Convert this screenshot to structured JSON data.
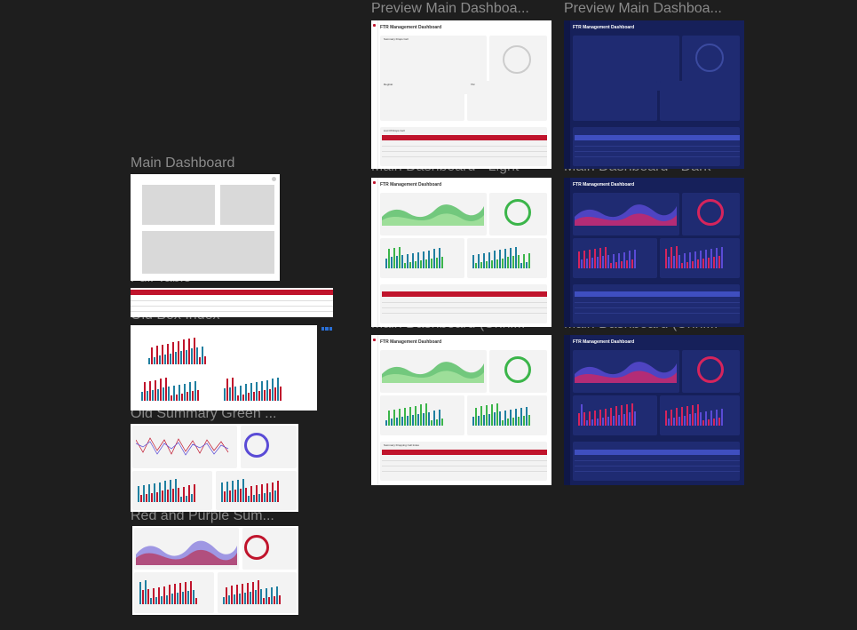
{
  "canvas": {
    "frames": [
      {
        "id": "preview-light",
        "label": "Preview Main Dashboa..."
      },
      {
        "id": "preview-dark",
        "label": "Preview Main Dashboa..."
      },
      {
        "id": "main-wire",
        "label": "Main Dashboard"
      },
      {
        "id": "main-light",
        "label": "Main Dashboard - Light"
      },
      {
        "id": "main-dark",
        "label": "Main Dashboard - Dark"
      },
      {
        "id": "full-table",
        "label": "Full Table"
      },
      {
        "id": "old-box",
        "label": "Old Box Index"
      },
      {
        "id": "unh-light",
        "label": "Main Dashboard (Unhi..."
      },
      {
        "id": "unh-dark",
        "label": "Main Dashboard (Unhi..."
      },
      {
        "id": "old-green",
        "label": "Old Summary Green ..."
      },
      {
        "id": "red-purple",
        "label": "Red and Purple Sum..."
      }
    ]
  },
  "dashboard": {
    "title": "FTR Management Dashboard",
    "summary_panel": "Summary Drops Cell",
    "donut_panel": "Summary Drops Cell",
    "left_chart": "RegCat",
    "right_chart": "TAI",
    "table_title": "List Of Drops Cell",
    "table_title_alt": "Summary Dropping Cell Index"
  },
  "colors": {
    "canvas_bg": "#1e1e1e",
    "label": "#8a8a8a",
    "accent_red": "#c0142c",
    "dark_bg": "#16205a",
    "green": "#3bb54a",
    "teal": "#1f7fa0",
    "purple": "#5a4bd6"
  }
}
